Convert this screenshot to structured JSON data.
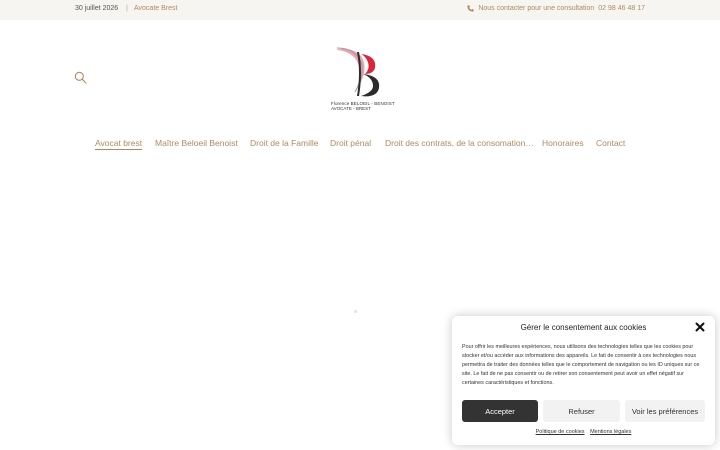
{
  "topbar": {
    "date": "30 juillet 2026",
    "separator": "|",
    "site_name": "Avocate Brest",
    "contact_label": "Nous contacter pour une consultation",
    "phone": "02 98 46 48 17",
    "icon": "phone-icon"
  },
  "header": {
    "search_icon": "search-icon",
    "logo": {
      "line1": "Florence BELOEIL - BENOIST",
      "line2": "AVOCATE - BREST",
      "colors": {
        "red": "#d9263a",
        "pink": "#f0a0ad",
        "gray": "#9c9c9c",
        "dark": "#2c2c2c"
      }
    }
  },
  "nav": {
    "items": [
      {
        "label": "Avocat brest",
        "active": true
      },
      {
        "label": "Maître Beloeil Benoist"
      },
      {
        "label": "Droit de la Famille"
      },
      {
        "label": "Droit pénal"
      },
      {
        "label": "Droit des contrats, de la consomation…"
      },
      {
        "label": "Honoraires"
      },
      {
        "label": "Contact"
      }
    ]
  },
  "cookie": {
    "title": "Gérer le consentement aux cookies",
    "text": "Pour offrir les meilleures expériences, nous utilisons des technologies telles que les cookies pour stocker et/ou accéder aux informations des appareils. Le fait de consentir à ces technologies nous permettra de traiter des données telles que le comportement de navigation ou les ID uniques sur ce site. Le fait de ne pas consentir ou de retirer son consentement peut avoir un effet négatif sur certaines caractéristiques et fonctions.",
    "accept": "Accepter",
    "refuse": "Refuser",
    "preferences": "Voir les préférences",
    "link_policy": "Politique de cookies",
    "link_legal": "Mentions légales"
  },
  "colors": {
    "accent": "#b08a5e",
    "topbar_bg": "#f6f5f2",
    "button_dark": "#333333",
    "button_light": "#f2f2f2"
  }
}
